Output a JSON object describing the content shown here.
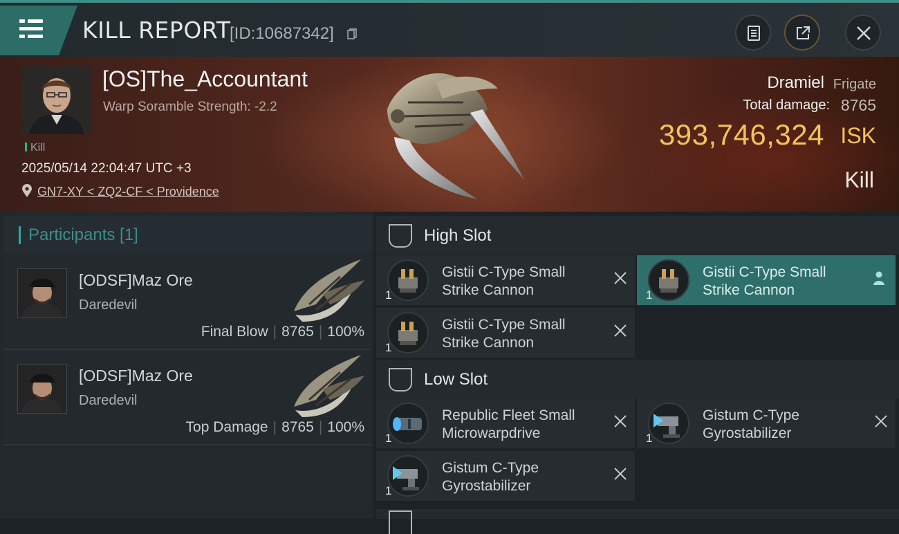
{
  "header": {
    "title": "KILL REPORT",
    "report_id": "[ID:10687342]"
  },
  "victim": {
    "name": "[OS]The_Accountant",
    "warp_scramble": "Warp Soramble Strength: -2.2",
    "kill_tag": "Kill",
    "timestamp": "2025/05/14 22:04:47 UTC +3",
    "location": "GN7-XY < ZQ2-CF < Providence",
    "ship_name": "Dramiel",
    "ship_class": "Frigate",
    "total_damage_label": "Total damage:",
    "total_damage": "8765",
    "isk_value": "393,746,324",
    "isk_unit": "ISK",
    "result": "Kill"
  },
  "participants": {
    "title": "Participants [1]",
    "rows": [
      {
        "name": "[ODSF]Maz Ore",
        "ship": "Daredevil",
        "role": "Final Blow",
        "damage": "8765",
        "percent": "100%"
      },
      {
        "name": "[ODSF]Maz Ore",
        "ship": "Daredevil",
        "role": "Top Damage",
        "damage": "8765",
        "percent": "100%"
      }
    ]
  },
  "fitting": {
    "high_slot": {
      "title": "High Slot",
      "modules": [
        {
          "qty": "1",
          "name_line1": "Gistii C-Type Small",
          "name_line2": "Strike Cannon"
        },
        {
          "qty": "1",
          "name_line1": "Gistii C-Type Small",
          "name_line2": "Strike Cannon"
        },
        {
          "qty": "1",
          "name_line1": "Gistii C-Type Small",
          "name_line2": "Strike Cannon"
        }
      ]
    },
    "low_slot": {
      "title": "Low Slot",
      "modules": [
        {
          "qty": "1",
          "name_line1": "Republic Fleet Small",
          "name_line2": "Microwarpdrive"
        },
        {
          "qty": "1",
          "name_line1": "Gistum C-Type",
          "name_line2": "Gyrostabilizer"
        },
        {
          "qty": "1",
          "name_line1": "Gistum C-Type",
          "name_line2": "Gyrostabilizer"
        }
      ]
    }
  },
  "colors": {
    "accent_teal": "#2c6d68",
    "isk_gold": "#f2c35c",
    "active_module": "#2f6f6b"
  }
}
